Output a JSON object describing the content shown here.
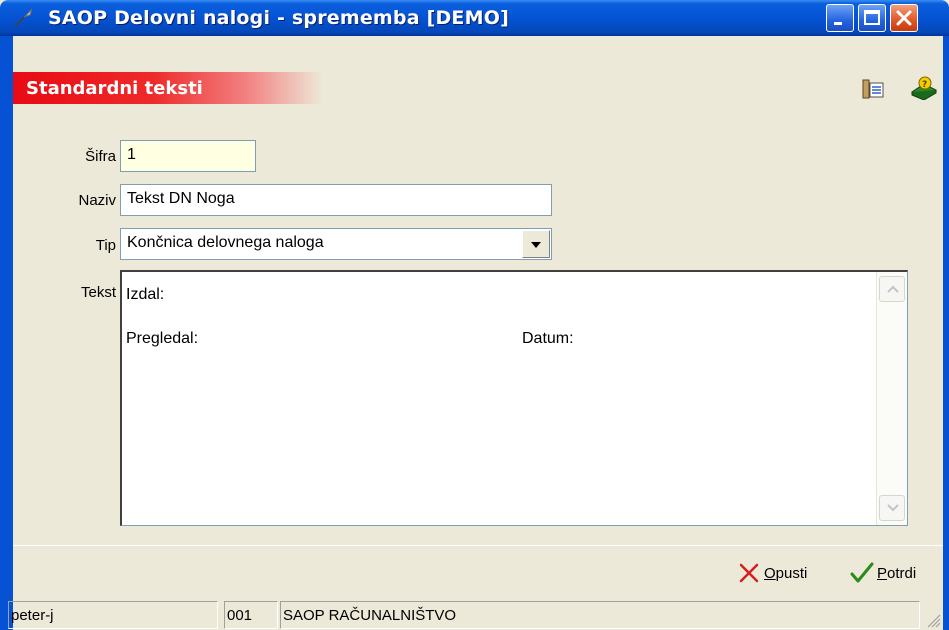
{
  "window": {
    "title": "SAOP Delovni nalogi - sprememba [DEMO]",
    "controls": {
      "minimize": "minimize",
      "maximize": "maximize",
      "close": "close"
    }
  },
  "header": {
    "title": "Standardni teksti",
    "icons": [
      "list-view-icon",
      "help-book-icon"
    ]
  },
  "form": {
    "sifra": {
      "label": "Šifra",
      "value": "1"
    },
    "naziv": {
      "label": "Naziv",
      "value": "Tekst DN Noga"
    },
    "tip": {
      "label": "Tip",
      "value": "Končnica delovnega naloga"
    },
    "tekst": {
      "label": "Tekst",
      "line1": "Izdal:",
      "line2_left": "Pregledal:",
      "line2_right": "Datum:"
    }
  },
  "actions": {
    "cancel": {
      "mnemonic": "O",
      "rest": "pusti"
    },
    "confirm": {
      "mnemonic": "P",
      "rest": "otrdi"
    }
  },
  "statusbar": {
    "user": "peter-j",
    "code": "001",
    "company": "SAOP RAČUNALNIŠTVO"
  },
  "colors": {
    "titlebar": "#0553d4",
    "header_red": "#e80a14",
    "background": "#ece9d8",
    "cancel_x": "#d42020",
    "confirm_check": "#2a8a1a"
  }
}
